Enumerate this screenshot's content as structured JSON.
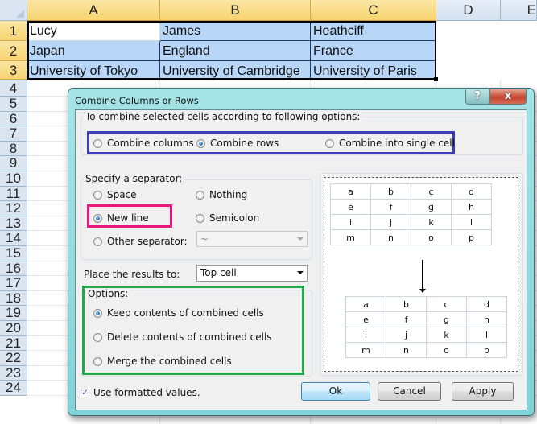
{
  "spreadsheet": {
    "columns": [
      "A",
      "B",
      "C",
      "D",
      "E"
    ],
    "rows": [
      "1",
      "2",
      "3",
      "4",
      "5",
      "6",
      "7",
      "8",
      "9",
      "10",
      "11",
      "12",
      "13",
      "14",
      "15",
      "16",
      "17",
      "18",
      "19",
      "20",
      "21",
      "22",
      "23",
      "24"
    ],
    "cells": [
      [
        "Lucy",
        "James",
        "Heathciff"
      ],
      [
        "Japan",
        "England",
        "France"
      ],
      [
        "University of Tokyo",
        "University of Cambridge",
        "University of Paris"
      ]
    ]
  },
  "dialog": {
    "title": "Combine Columns or Rows",
    "help_label": "?",
    "close_label": "x",
    "combine_group": {
      "label": "To combine selected cells according to following options:",
      "options": [
        {
          "label": "Combine columns",
          "selected": false
        },
        {
          "label": "Combine rows",
          "selected": true
        },
        {
          "label": "Combine into single cell",
          "selected": false
        }
      ],
      "highlight_color": "#3a3fb8"
    },
    "separator_group": {
      "label": "Specify a separator:",
      "options": [
        {
          "label": "Space",
          "selected": false
        },
        {
          "label": "Nothing",
          "selected": false
        },
        {
          "label": "New line",
          "selected": true
        },
        {
          "label": "Semicolon",
          "selected": false
        },
        {
          "label": "Other separator:",
          "selected": false
        }
      ],
      "other_value": "~",
      "highlight_color": "#e8177f"
    },
    "place_results": {
      "label": "Place the results to:",
      "value": "Top cell"
    },
    "options_group": {
      "label": "Options:",
      "options": [
        {
          "label": "Keep contents of combined cells",
          "selected": true
        },
        {
          "label": "Delete contents of combined cells",
          "selected": false
        },
        {
          "label": "Merge the combined cells",
          "selected": false
        }
      ],
      "highlight_color": "#1fa84a"
    },
    "preview": {
      "before": [
        [
          "a",
          "b",
          "c",
          "d"
        ],
        [
          "e",
          "f",
          "g",
          "h"
        ],
        [
          "i",
          "j",
          "k",
          "l"
        ],
        [
          "m",
          "n",
          "o",
          "p"
        ]
      ],
      "after": [
        [
          "a",
          "b",
          "c",
          "d"
        ],
        [
          "e",
          "f",
          "g",
          "h"
        ],
        [
          "i",
          "j",
          "k",
          "l"
        ],
        [
          "m",
          "n",
          "o",
          "p"
        ]
      ]
    },
    "use_formatted": {
      "label": "Use formatted values.",
      "checked": true
    },
    "buttons": {
      "ok": "Ok",
      "cancel": "Cancel",
      "apply": "Apply"
    }
  }
}
